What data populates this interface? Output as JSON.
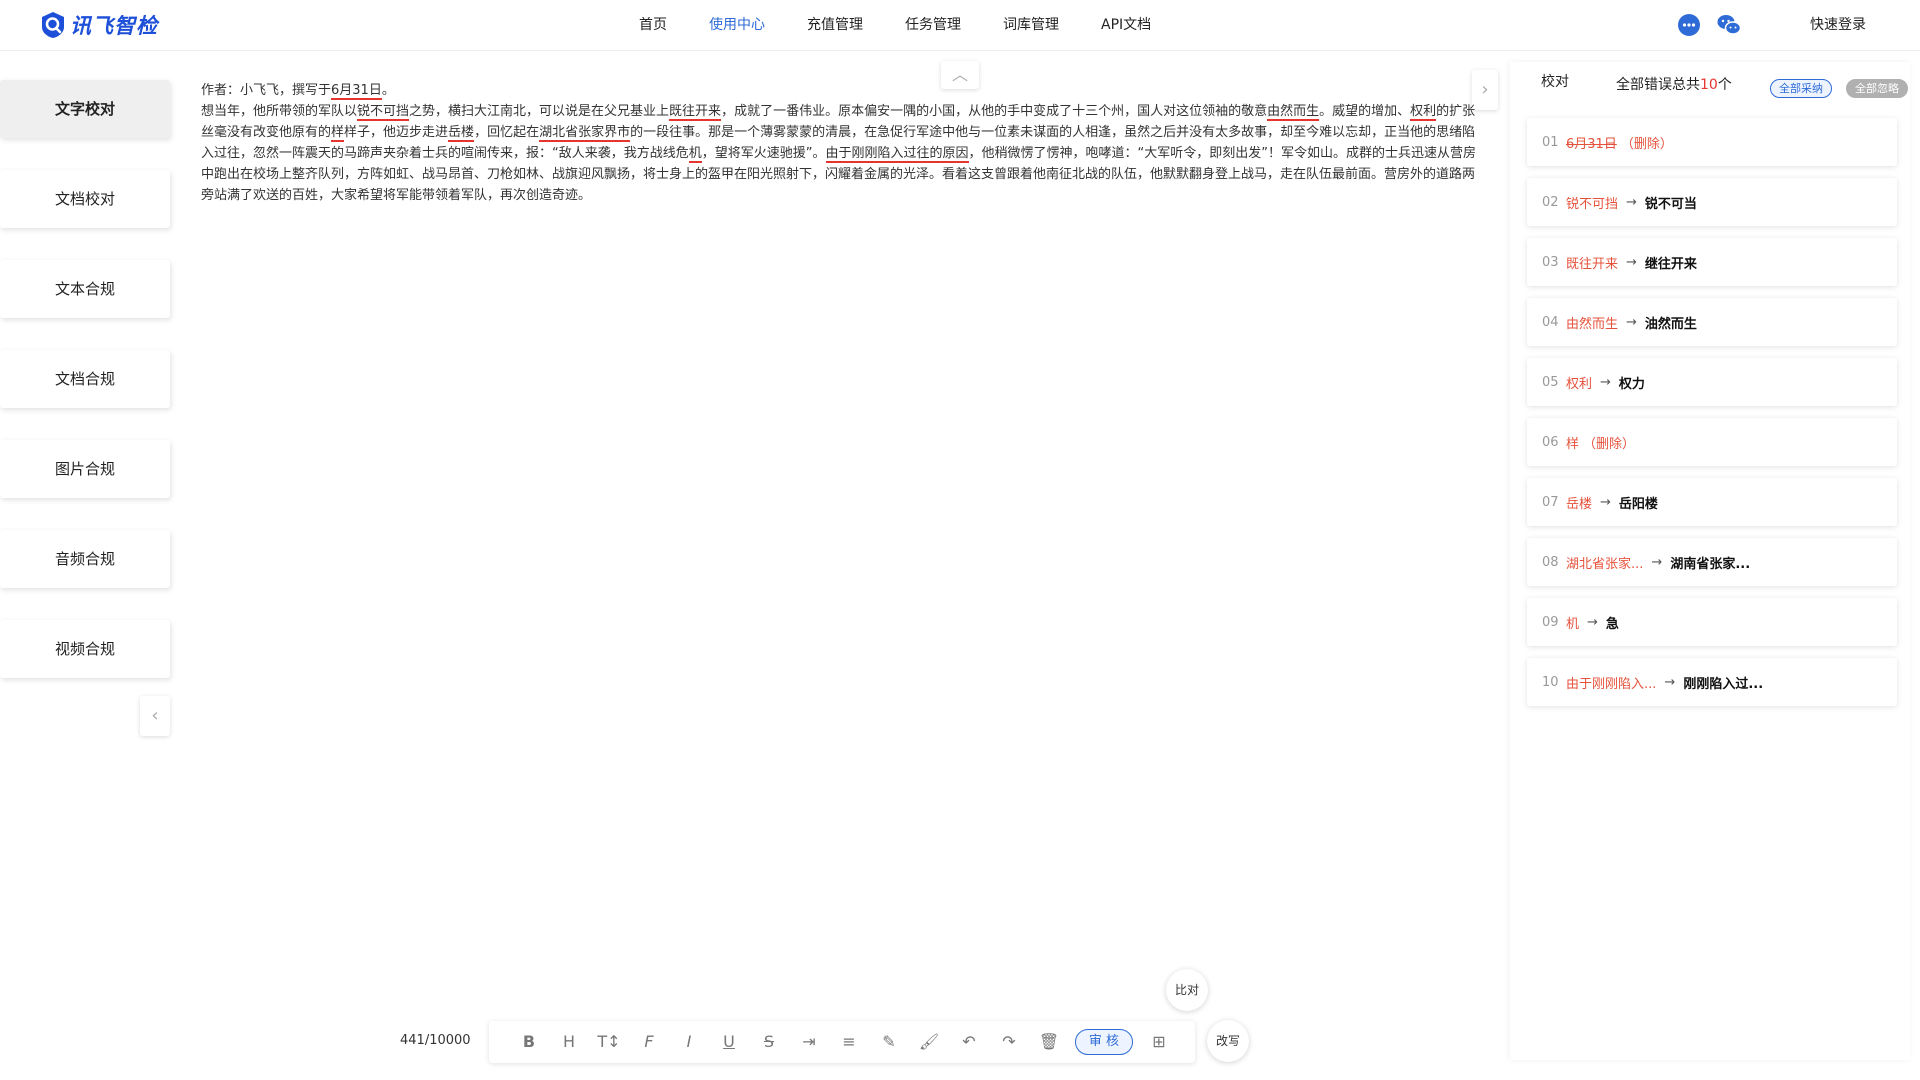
{
  "header": {
    "logo_text": "讯飞智检",
    "nav": [
      {
        "label": "首页",
        "active": false
      },
      {
        "label": "使用中心",
        "active": true
      },
      {
        "label": "充值管理",
        "active": false
      },
      {
        "label": "任务管理",
        "active": false
      },
      {
        "label": "词库管理",
        "active": false
      },
      {
        "label": "API文档",
        "active": false
      }
    ],
    "login_label": "快速登录",
    "accent": "#2e6bd6"
  },
  "sidebar": {
    "items": [
      {
        "label": "文字校对"
      },
      {
        "label": "文档校对"
      },
      {
        "label": "文本合规"
      },
      {
        "label": "文档合规"
      },
      {
        "label": "图片合规"
      },
      {
        "label": "音频合规"
      },
      {
        "label": "视频合规"
      }
    ]
  },
  "editor": {
    "line1": [
      "作者：小飞飞，撰写于",
      "6月31日",
      "。"
    ],
    "para": {
      "t0": "想当年，他所带领的军队以",
      "e1": "锐不可挡",
      "t1": "之势，横扫大江南北，可以说是在父兄基业上",
      "e2": "既往开来",
      "t2": "，成就了一番伟业。原本偏安一隅的小国，从他的手中变成了十三个州，国人对这位领袖的敬意",
      "e3": "由然而生",
      "t3": "。威望的增加、",
      "e4": "权利",
      "t4": "的扩张丝毫没有改变他原有的",
      "e5": "样",
      "t5": "样子，他迈步走进",
      "e6": "岳楼",
      "t6": "，回忆起在",
      "e7": "湖北省张家界市",
      "t7": "的一段往事。那是一个薄雾蒙蒙的清晨，在急促行军途中他与一位素未谋面的人相逢，虽然之后并没有太多故事，却至今难以忘却，正当他的思绪陷入过往，忽然一阵震天的马蹄声夹杂着士兵的喧闹传来，报：“敌人来袭，我方战线危",
      "e8": "机",
      "t8": "，望将军火速驰援”。",
      "e9": "由于刚刚陷入过往的原因",
      "t9": "，他稍微愣了愣神，咆哮道：“大军听令，即刻出发”！军令如山。成群的士兵迅速从营房中跑出在校场上整齐队列，方阵如虹、战马昂首、刀枪如林、战旗迎风飘扬，将士身上的盔甲在阳光照射下，闪耀着金属的光泽。看着这支曾跟着他南征北战的队伍，他默默翻身登上战马，走在队伍最前面。营房外的道路两旁站满了欢送的百姓，大家希望将军能带领着军队，再次创造奇迹。"
    }
  },
  "toolbar": {
    "count": "441/10000",
    "buttons": [
      "B",
      "H",
      "T↕",
      "F",
      "I",
      "U",
      "S"
    ],
    "audit_label": "审 核",
    "compare_label": "比对",
    "rewrite_label": "改写"
  },
  "panel": {
    "tab_proof": "校对",
    "total_prefix": "全部错误总共",
    "total_count": "10",
    "total_suffix": "个",
    "accept_all": "全部采纳",
    "ignore_all": "全部忽略",
    "errors": [
      {
        "idx": "01",
        "old": "6月31日",
        "del": true,
        "new": "",
        "note": "（删除）"
      },
      {
        "idx": "02",
        "old": "锐不可挡",
        "del": false,
        "new": "锐不可当",
        "note": ""
      },
      {
        "idx": "03",
        "old": "既往开来",
        "del": false,
        "new": "继往开来",
        "note": ""
      },
      {
        "idx": "04",
        "old": "由然而生",
        "del": false,
        "new": "油然而生",
        "note": ""
      },
      {
        "idx": "05",
        "old": "权利",
        "del": false,
        "new": "权力",
        "note": ""
      },
      {
        "idx": "06",
        "old": "样",
        "del": false,
        "new": "",
        "note": "（删除）"
      },
      {
        "idx": "07",
        "old": "岳楼",
        "del": false,
        "new": "岳阳楼",
        "note": ""
      },
      {
        "idx": "08",
        "old": "湖北省张家...",
        "del": false,
        "new": "湖南省张家...",
        "note": ""
      },
      {
        "idx": "09",
        "old": "机",
        "del": false,
        "new": "急",
        "note": ""
      },
      {
        "idx": "10",
        "old": "由于刚刚陷入...",
        "del": false,
        "new": "刚刚陷入过...",
        "note": ""
      }
    ],
    "error_color": "#e5523b"
  }
}
